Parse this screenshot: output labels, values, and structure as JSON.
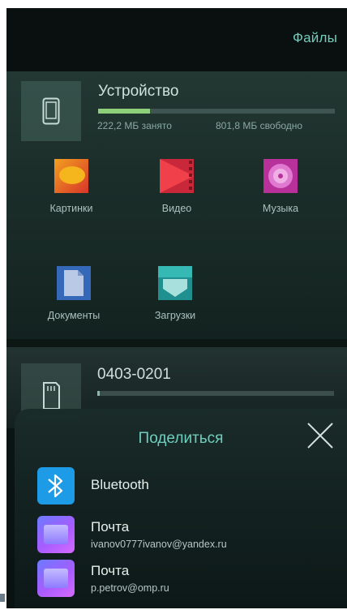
{
  "header": {
    "title": "Файлы"
  },
  "device": {
    "title": "Устройство",
    "used_label": "222,2 МБ занято",
    "free_label": "801,8 МБ свободно",
    "used_fraction": 0.22
  },
  "categories": [
    {
      "label": "Картинки",
      "icon": "pictures-icon",
      "color": "#e8562a"
    },
    {
      "label": "Видео",
      "icon": "video-icon",
      "color": "#e53642"
    },
    {
      "label": "Музыка",
      "icon": "music-icon",
      "color": "#d23fb0"
    },
    {
      "label": "Документы",
      "icon": "documents-icon",
      "color": "#3a7fd6"
    },
    {
      "label": "Загрузки",
      "icon": "downloads-icon",
      "color": "#2ea6a6"
    }
  ],
  "sd_card": {
    "title": "0403-0201",
    "used_fraction": 0.01
  },
  "share_sheet": {
    "title": "Поделиться",
    "items": [
      {
        "title": "Bluetooth",
        "subtitle": "",
        "icon": "bluetooth-icon"
      },
      {
        "title": "Почта",
        "subtitle": "ivanov0777ivanov@yandex.ru",
        "icon": "mail-icon"
      },
      {
        "title": "Почта",
        "subtitle": "p.petrov@omp.ru",
        "icon": "mail-icon"
      }
    ]
  },
  "colors": {
    "accent": "#6fcfbf",
    "storage_fill": "#8ed07a",
    "bluetooth": "#1e9be6"
  }
}
